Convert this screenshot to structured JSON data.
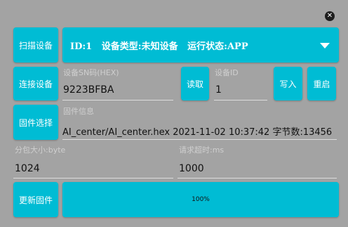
{
  "window": {
    "close_glyph": "✕"
  },
  "buttons": {
    "scan": "扫描设备",
    "connect": "连接设备",
    "firmware_select": "固件选择",
    "read": "读取",
    "write": "写入",
    "restart": "重启",
    "update_firmware": "更新固件"
  },
  "device": {
    "selected": "ID:1   设备类型:未知设备   运行状态:APP"
  },
  "fields": {
    "sn": {
      "label": "设备SN码(HEX)",
      "value": "9223BFBA"
    },
    "device_id": {
      "label": "设备ID",
      "value": "1"
    },
    "firmware_info": {
      "label": "固件信息",
      "value": "AI_center/AI_center.hex 2021-11-02 10:37:42 字节数:13456"
    },
    "packet_size": {
      "label": "分包大小:byte",
      "value": "1024"
    },
    "request_timeout": {
      "label": "请求超时:ms",
      "value": "1000"
    }
  },
  "progress": {
    "label": "100%",
    "fraction": 1.0
  },
  "colors": {
    "background": "#a3a3a3",
    "accent": "#00bcd4",
    "text_dark": "#111111",
    "label_gray": "#cfcfcf"
  }
}
